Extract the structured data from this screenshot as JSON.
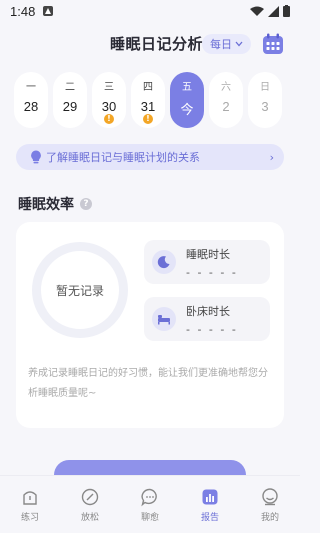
{
  "status_bar": {
    "time": "1:48"
  },
  "header": {
    "title": "睡眠日记分析",
    "period_label": "每日",
    "colors": {
      "accent": "#7b7fe4"
    }
  },
  "week": [
    {
      "weekday": "一",
      "date": "28",
      "state": "normal",
      "warning": false
    },
    {
      "weekday": "二",
      "date": "29",
      "state": "normal",
      "warning": false
    },
    {
      "weekday": "三",
      "date": "30",
      "state": "normal",
      "warning": true
    },
    {
      "weekday": "四",
      "date": "31",
      "state": "normal",
      "warning": true
    },
    {
      "weekday": "五",
      "date": "今",
      "state": "active",
      "warning": false
    },
    {
      "weekday": "六",
      "date": "2",
      "state": "future",
      "warning": false
    },
    {
      "weekday": "日",
      "date": "3",
      "state": "future",
      "warning": false
    }
  ],
  "warning_mark": "!",
  "banner": {
    "text": "了解睡眠日记与睡眠计划的关系",
    "chevron": "›"
  },
  "efficiency": {
    "title": "睡眠效率",
    "help": "?",
    "ring_text": "暂无记录",
    "metrics": [
      {
        "label": "睡眠时长",
        "value": "- - - - -",
        "icon": "moon-icon"
      },
      {
        "label": "卧床时长",
        "value": "- - - - -",
        "icon": "bed-icon"
      }
    ],
    "hint": "养成记录睡眠日记的好习惯，能让我们更准确地帮您分析睡眠质量呢~"
  },
  "tabs": [
    {
      "label": "练习",
      "icon": "practice-icon",
      "active": false
    },
    {
      "label": "放松",
      "icon": "relax-icon",
      "active": false
    },
    {
      "label": "聊愈",
      "icon": "chat-icon",
      "active": false
    },
    {
      "label": "报告",
      "icon": "report-icon",
      "active": true
    },
    {
      "label": "我的",
      "icon": "profile-icon",
      "active": false
    }
  ]
}
